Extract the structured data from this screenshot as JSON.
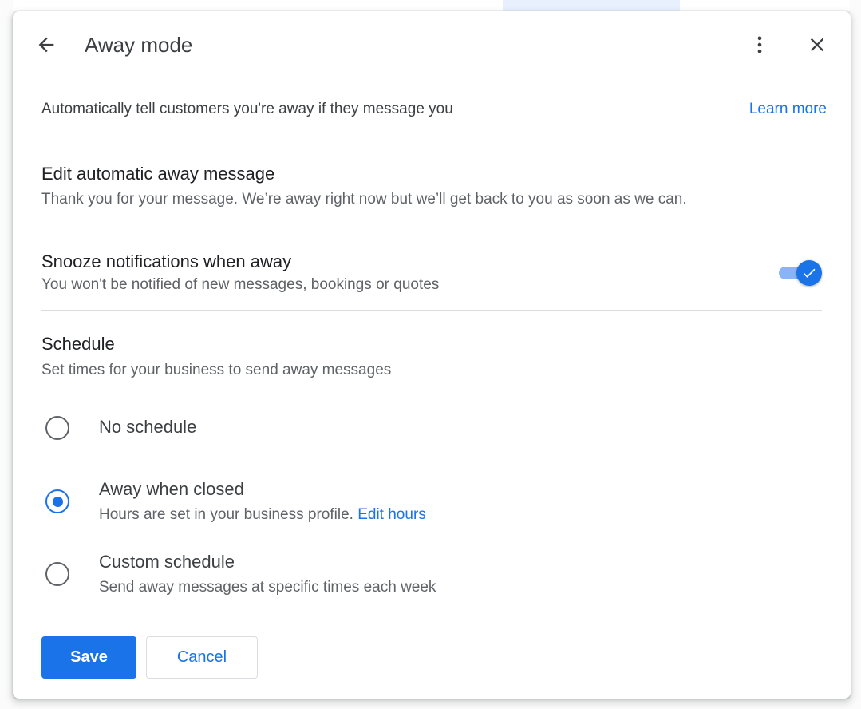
{
  "dialog": {
    "title": "Away mode",
    "icons": {
      "back": "arrow-back-icon",
      "more": "more-vert-icon",
      "close": "close-icon"
    }
  },
  "intro": {
    "text": "Automatically tell customers you're away if they message you",
    "learn_more": "Learn more"
  },
  "away_message": {
    "title": "Edit automatic away message",
    "text": "Thank you for your message. We’re away right now but we’ll get back to you as soon as we can."
  },
  "snooze": {
    "title": "Snooze notifications when away",
    "subtitle": "You won't be notified of new messages, bookings or quotes",
    "enabled": true
  },
  "schedule": {
    "title": "Schedule",
    "subtitle": "Set times for your business to send away messages",
    "options": [
      {
        "label": "No schedule",
        "checked": false
      },
      {
        "label": "Away when closed",
        "description": "Hours are set in your business profile. ",
        "link": "Edit hours",
        "checked": true
      },
      {
        "label": "Custom schedule",
        "description": "Send away messages at specific times each week",
        "checked": false
      }
    ]
  },
  "actions": {
    "save": "Save",
    "cancel": "Cancel"
  },
  "colors": {
    "accent": "#1a73e8",
    "toggle_track": "#8ab4f8",
    "divider": "#dadce0",
    "text": "#3c4043",
    "secondary_text": "#5f6368"
  }
}
